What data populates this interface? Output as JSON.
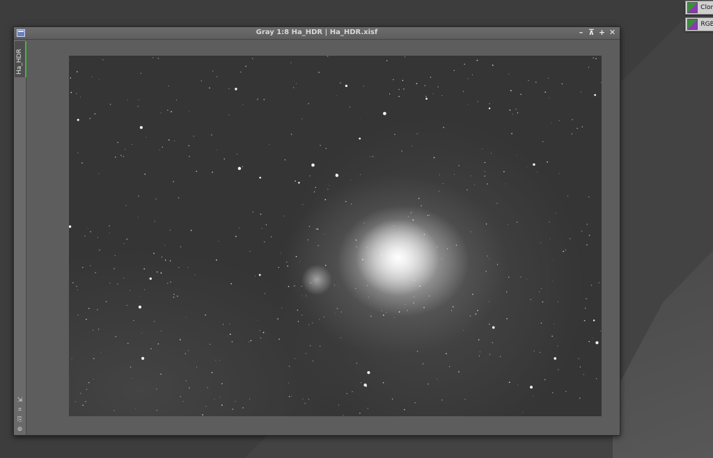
{
  "window": {
    "title": "Gray 1:8 Ha_HDR | Ha_HDR.xisf",
    "controls": [
      "–",
      "⊼",
      "+",
      "✕"
    ]
  },
  "view_tab": {
    "label": "Ha_HDR"
  },
  "desktop_icons": [
    {
      "label": "Clon"
    },
    {
      "label": "RGB"
    }
  ],
  "sidebar_tools": [
    "⇲",
    "⌗",
    "⎘",
    "⊚"
  ],
  "colors": {
    "tab_accent": "#3fb83f",
    "title_text": "#d8d8d8"
  }
}
